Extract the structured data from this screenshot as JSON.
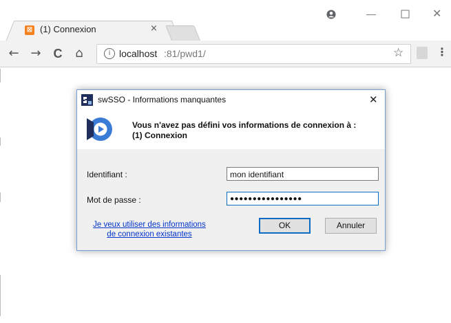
{
  "browser": {
    "tab_title": "(1) Connexion",
    "tab_close": "×",
    "url_host": "localhost",
    "url_rest": ":81/pwd1/",
    "close_glyph": "✕",
    "minimize_glyph": "—",
    "menu_glyph": "⋮",
    "star_glyph": "☆",
    "back_glyph": "←",
    "forward_glyph": "→",
    "reload_glyph": "C",
    "home_glyph": "⌂",
    "info_glyph": "i"
  },
  "dialog": {
    "title": "swSSO - Informations manquantes",
    "close_glyph": "✕",
    "message_line1": "Vous n'avez pas défini vos informations de connexion à :",
    "message_line2": "(1) Connexion",
    "identifier_label": "Identifiant :",
    "identifier_value": "mon identifiant",
    "password_label": "Mot de passe :",
    "password_value": "●●●●●●●●●●●●●●●●",
    "link_line1": "Je veux utiliser des informations",
    "link_line2": "de connexion existantes",
    "ok_label": "OK",
    "cancel_label": "Annuler"
  },
  "colors": {
    "accent_blue": "#0a6bc5",
    "logo_blue": "#3a7bd5",
    "favicon_orange": "#f58220"
  },
  "icons": [
    "xampp-favicon",
    "profile-icon",
    "back-arrow-icon",
    "forward-arrow-icon",
    "reload-icon",
    "home-icon",
    "info-icon",
    "star-icon",
    "pdf-extension-icon",
    "kebab-menu-icon",
    "swsso-app-icon",
    "swsso-logo"
  ]
}
